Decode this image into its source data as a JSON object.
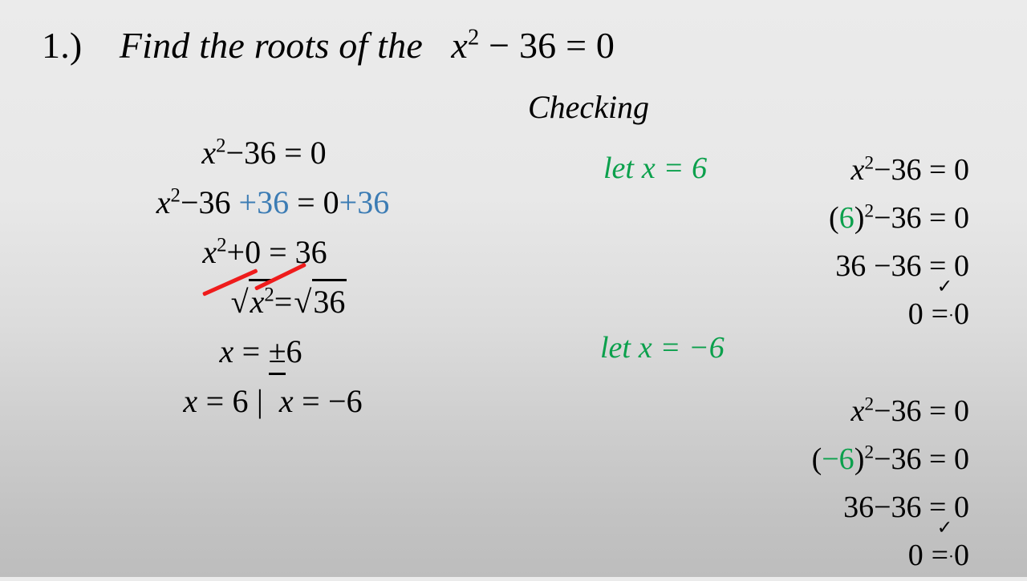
{
  "slide": {
    "background_top_color": "#ebebeb",
    "background_bottom_color": "#bdbdbd",
    "accent_blue": "#3c7cb4",
    "accent_green": "#0ba04c",
    "accent_red": "#ef1c1c",
    "text_color": "#000000"
  },
  "title": {
    "number": "1.)",
    "prompt": "Find the roots of the",
    "equation_base": "x",
    "equation_exponent": "2",
    "equation_rest": "− 36 = 0"
  },
  "work": {
    "lines": [
      {
        "id": "original-equation",
        "label": "x² − 36 = 0",
        "parts": [
          {
            "text": "x",
            "style": "italic",
            "color": "black"
          },
          {
            "text": "2",
            "style": "sup",
            "color": "black"
          },
          {
            "text": "−36 = 0",
            "style": "normal",
            "color": "black"
          }
        ]
      },
      {
        "id": "add-36-both-sides",
        "label": "x² −36 +36 = 0+36",
        "parts": [
          {
            "text": "x",
            "style": "italic",
            "color": "black"
          },
          {
            "text": "2",
            "style": "sup",
            "color": "black"
          },
          {
            "text": "−36 ",
            "style": "normal",
            "color": "black"
          },
          {
            "text": "+36",
            "style": "normal",
            "color": "blue"
          },
          {
            "text": " = 0",
            "style": "normal",
            "color": "black"
          },
          {
            "text": "+36",
            "style": "normal",
            "color": "blue"
          }
        ]
      },
      {
        "id": "simplified",
        "label": "x² +0 = 36",
        "parts": [
          {
            "text": "x",
            "style": "italic",
            "color": "black"
          },
          {
            "text": "2",
            "style": "sup",
            "color": "black"
          },
          {
            "text": "+0 = 36",
            "style": "normal",
            "color": "black"
          }
        ]
      },
      {
        "id": "square-root-both-sides",
        "label": "√(x²) = √36",
        "note": "radical and exponent crossed out in red"
      },
      {
        "id": "plus-minus-six",
        "label": "x = ±6"
      },
      {
        "id": "two-roots",
        "label": "x = 6 | x = −6"
      }
    ],
    "radical_glyph": "√",
    "radicand_left_base": "x",
    "radicand_left_exponent": "2",
    "equals": "=",
    "radicand_right": "36",
    "pm_line": {
      "lhs": "x",
      "eq": "=",
      "rhs_sign": "±",
      "rhs_value": "6"
    },
    "roots_line": {
      "left": "x = 6",
      "divider": "|",
      "right_lhs": "x",
      "right_eq": "=",
      "right_value": "−6"
    }
  },
  "checking": {
    "heading": "Checking",
    "blocks": [
      {
        "id": "check-positive-six",
        "let_label": "let x = 6",
        "let_var": "x",
        "let_eq": "=",
        "let_value": "6",
        "rows": [
          {
            "id": "check1-row1",
            "label": "x² −36 = 0"
          },
          {
            "id": "check1-row2",
            "label": "(6)² −36 = 0",
            "substituted_value": "6"
          },
          {
            "id": "check1-row3",
            "label": "36 −36 = 0"
          },
          {
            "id": "check1-row4",
            "label": "0 = 0",
            "has_checkmark": true,
            "checkmark": "✓"
          }
        ]
      },
      {
        "id": "check-negative-six",
        "let_label": "let x = −6",
        "let_var": "x",
        "let_eq": "=",
        "let_value": "−6",
        "rows": [
          {
            "id": "check2-row1",
            "label": "x² −36 = 0"
          },
          {
            "id": "check2-row2",
            "label": "(−6)² −36 = 0",
            "substituted_value": "−6"
          },
          {
            "id": "check2-row3",
            "label": "36 −36 = 0"
          },
          {
            "id": "check2-row4",
            "label": "0 = 0",
            "has_checkmark": true,
            "checkmark": "✓"
          }
        ]
      }
    ],
    "tokens": {
      "x": "x",
      "two": "2",
      "minus36_eq_0": "−36 = 0",
      "open_paren": "(",
      "close_paren": ")",
      "thirtysix": "36",
      "zero": "0",
      "equals": "=",
      "dot": "·",
      "let_word": "let"
    }
  }
}
